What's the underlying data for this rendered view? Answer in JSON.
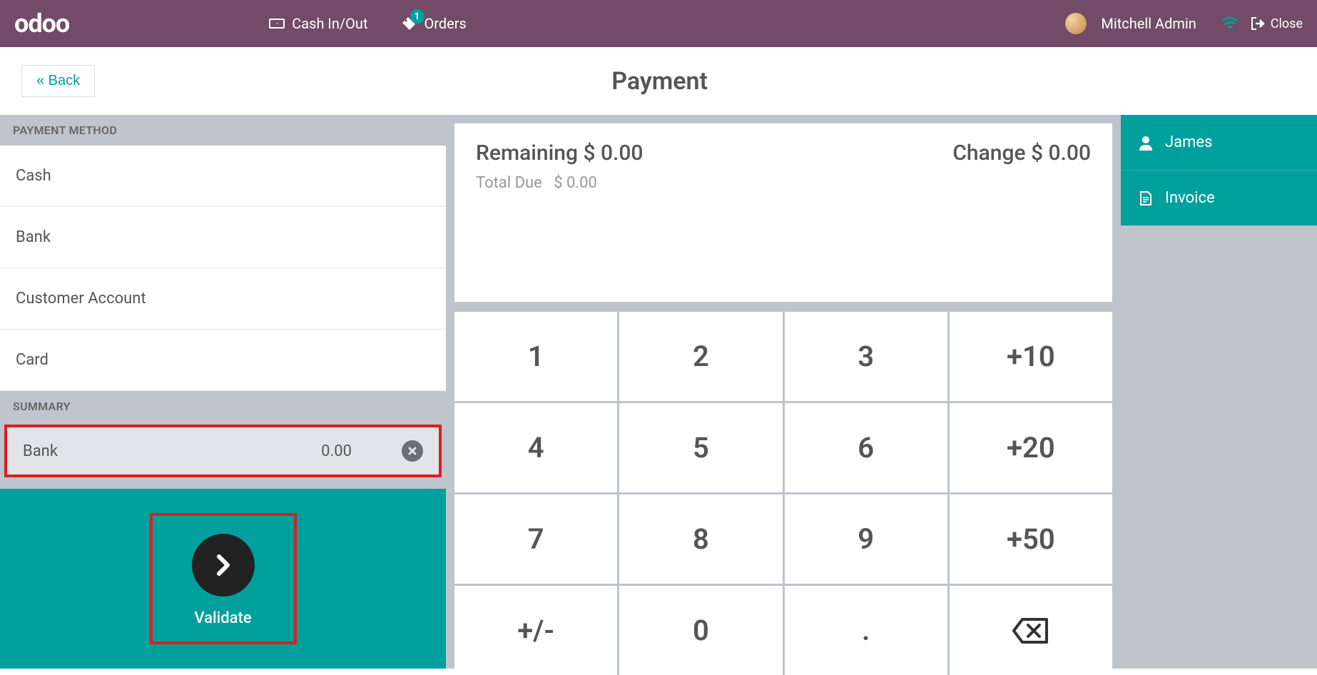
{
  "topbar": {
    "logo": "odoo",
    "cash_label": "Cash In/Out",
    "orders_label": "Orders",
    "orders_badge": "1",
    "user_name": "Mitchell Admin",
    "close_label": "Close"
  },
  "header": {
    "back_label": "« Back",
    "title": "Payment"
  },
  "left": {
    "payment_method_label": "PAYMENT METHOD",
    "methods": [
      "Cash",
      "Bank",
      "Customer Account",
      "Card"
    ],
    "summary_label": "SUMMARY",
    "summary_line": {
      "name": "Bank",
      "amount": "0.00"
    },
    "validate_label": "Validate"
  },
  "center": {
    "remaining_label": "Remaining",
    "remaining_value": "$ 0.00",
    "change_label": "Change",
    "change_value": "$ 0.00",
    "total_due_label": "Total Due",
    "total_due_value": "$ 0.00",
    "numpad": [
      "1",
      "2",
      "3",
      "+10",
      "4",
      "5",
      "6",
      "+20",
      "7",
      "8",
      "9",
      "+50",
      "+/-",
      "0",
      ".",
      "⌫"
    ]
  },
  "right": {
    "customer": "James",
    "invoice": "Invoice"
  }
}
